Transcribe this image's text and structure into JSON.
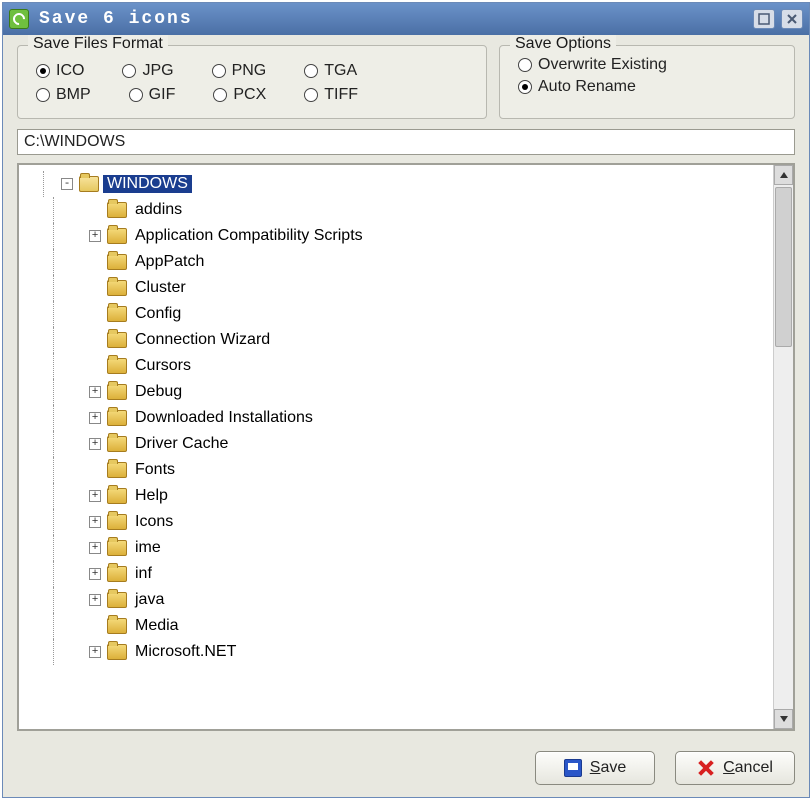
{
  "window": {
    "title": "Save 6 icons"
  },
  "formats": {
    "legend": "Save Files Format",
    "row1": [
      {
        "label": "ICO",
        "checked": true
      },
      {
        "label": "JPG",
        "checked": false
      },
      {
        "label": "PNG",
        "checked": false
      },
      {
        "label": "TGA",
        "checked": false
      }
    ],
    "row2": [
      {
        "label": "BMP",
        "checked": false
      },
      {
        "label": "GIF",
        "checked": false
      },
      {
        "label": "PCX",
        "checked": false
      },
      {
        "label": "TIFF",
        "checked": false
      }
    ]
  },
  "options": {
    "legend": "Save Options",
    "items": [
      {
        "label": "Overwrite Existing",
        "checked": false
      },
      {
        "label": "Auto Rename",
        "checked": true
      }
    ]
  },
  "path": "C:\\WINDOWS",
  "tree": {
    "root": {
      "label": "WINDOWS",
      "selected": true,
      "expander": "-",
      "open": true
    },
    "children": [
      {
        "label": "addins",
        "expander": ""
      },
      {
        "label": "Application Compatibility Scripts",
        "expander": "+"
      },
      {
        "label": "AppPatch",
        "expander": ""
      },
      {
        "label": "Cluster",
        "expander": ""
      },
      {
        "label": "Config",
        "expander": ""
      },
      {
        "label": "Connection Wizard",
        "expander": ""
      },
      {
        "label": "Cursors",
        "expander": ""
      },
      {
        "label": "Debug",
        "expander": "+"
      },
      {
        "label": "Downloaded Installations",
        "expander": "+"
      },
      {
        "label": "Driver Cache",
        "expander": "+"
      },
      {
        "label": "Fonts",
        "expander": ""
      },
      {
        "label": "Help",
        "expander": "+"
      },
      {
        "label": "Icons",
        "expander": "+"
      },
      {
        "label": "ime",
        "expander": "+"
      },
      {
        "label": "inf",
        "expander": "+"
      },
      {
        "label": "java",
        "expander": "+"
      },
      {
        "label": "Media",
        "expander": ""
      },
      {
        "label": "Microsoft.NET",
        "expander": "+"
      }
    ]
  },
  "buttons": {
    "save": "Save",
    "cancel": "Cancel"
  }
}
